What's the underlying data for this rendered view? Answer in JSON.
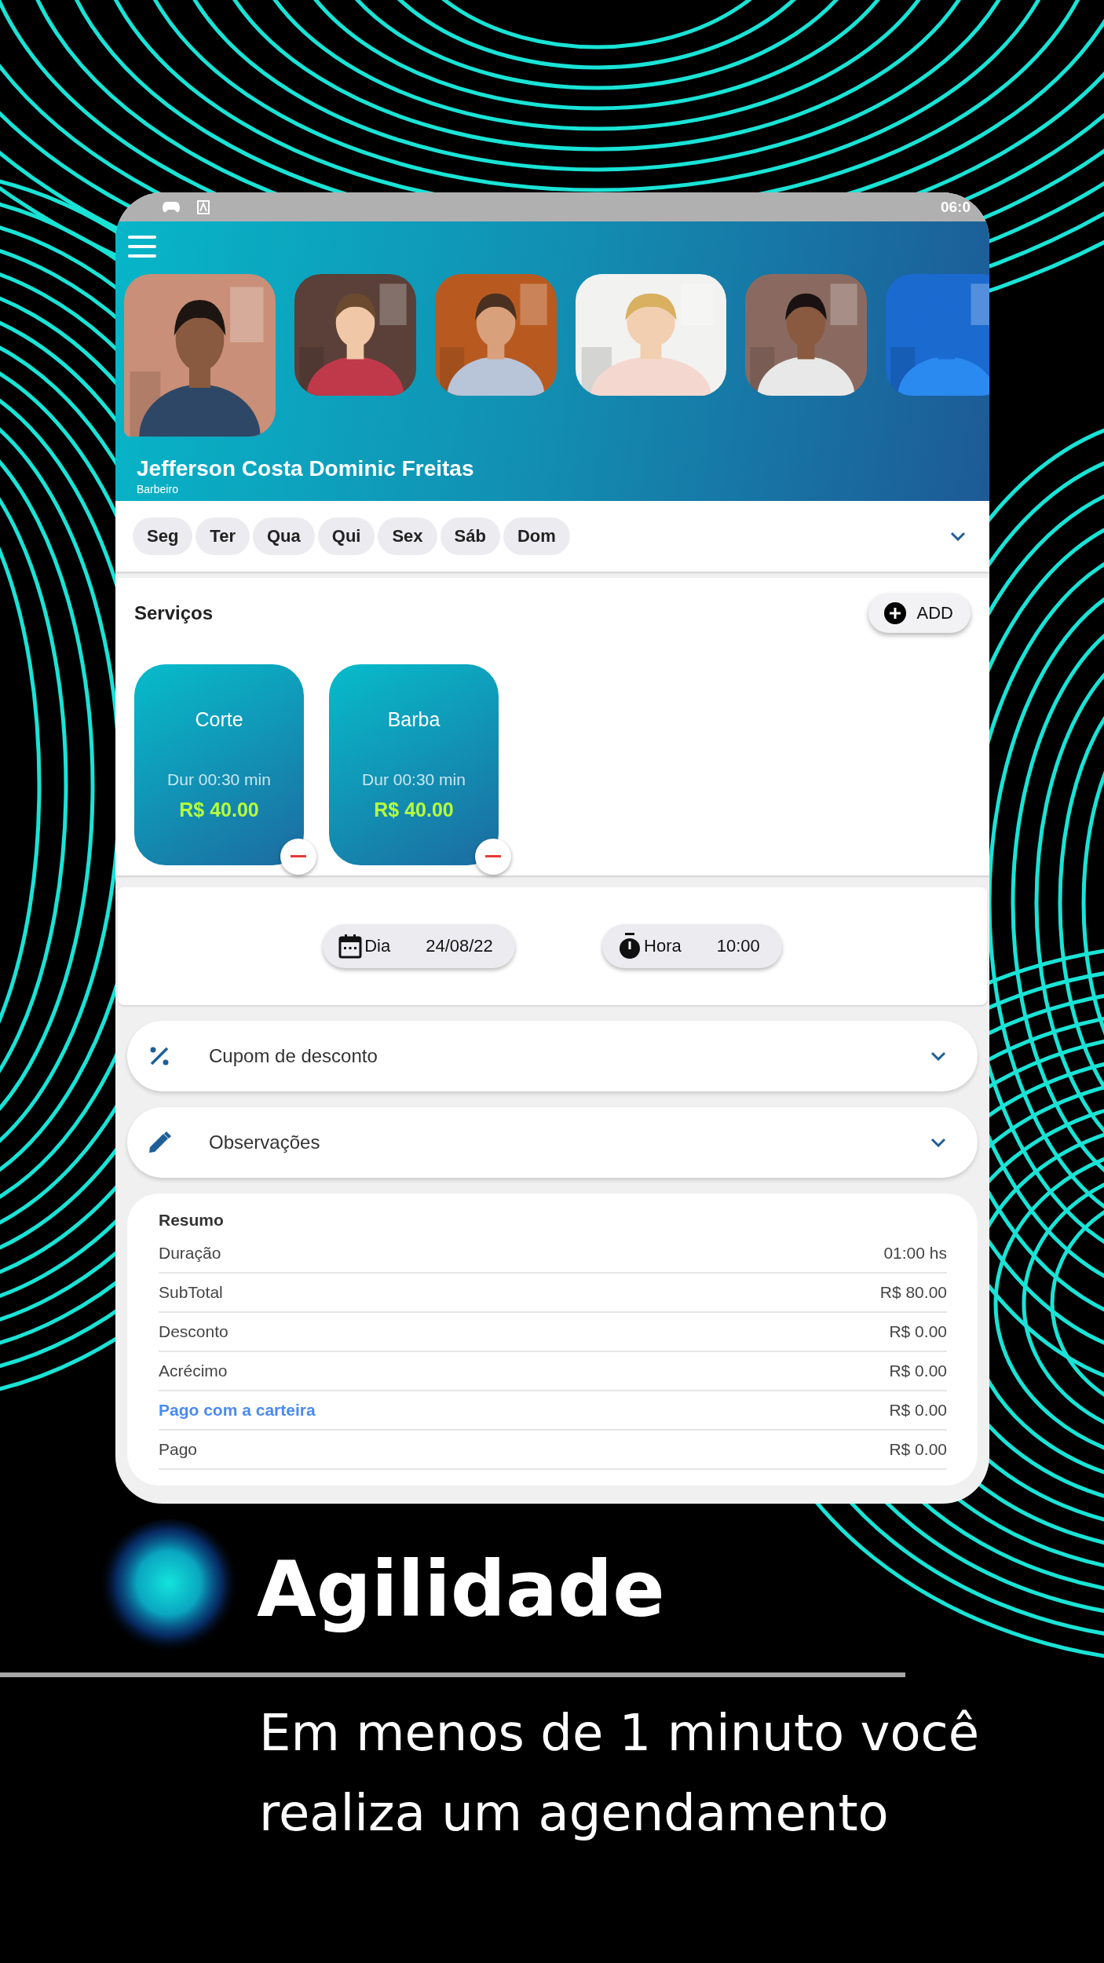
{
  "status_bar": {
    "time": "06:0"
  },
  "header": {
    "photos": [
      {
        "kind": "picture",
        "selected": true
      },
      {
        "kind": "picture",
        "selected": false
      },
      {
        "kind": "picture",
        "selected": false
      },
      {
        "kind": "picture",
        "selected": false
      },
      {
        "kind": "picture",
        "selected": false
      },
      {
        "kind": "picture",
        "selected": false
      }
    ],
    "name": "Jefferson Costa Dominic Freitas",
    "role": "Barbeiro"
  },
  "days": [
    "Seg",
    "Ter",
    "Qua",
    "Qui",
    "Sex",
    "Sáb",
    "Dom"
  ],
  "services": {
    "title": "Serviços",
    "add_button": "ADD",
    "items": [
      {
        "name": "Corte",
        "duration": "Dur 00:30 min",
        "price": "R$ 40.00"
      },
      {
        "name": "Barba",
        "duration": "Dur 00:30 min",
        "price": "R$ 40.00"
      }
    ]
  },
  "schedule": {
    "date_label": "Dia",
    "date": "24/08/22",
    "time_label": "Hora",
    "time": "10:00"
  },
  "sections": [
    {
      "kind": "coupon",
      "label": "Cupom de desconto"
    },
    {
      "kind": "notes",
      "label": "Observações"
    }
  ],
  "summary": {
    "title": "Resumo",
    "rows": [
      {
        "kind": "plain",
        "label": "Duração",
        "value": "01:00 hs"
      },
      {
        "kind": "plain",
        "label": "SubTotal",
        "value": "R$ 80.00"
      },
      {
        "kind": "plain",
        "label": "Desconto",
        "value": "R$ 0.00"
      },
      {
        "kind": "plain",
        "label": "Acrécimo",
        "value": "R$ 0.00"
      },
      {
        "kind": "link",
        "label": "Pago com a carteira",
        "value": "R$ 0.00"
      },
      {
        "kind": "plain",
        "label": "Pago",
        "value": "R$ 0.00"
      }
    ]
  },
  "promo": {
    "title": "Agilidade",
    "text": "Em menos de 1 minuto você realiza um agendamento"
  }
}
